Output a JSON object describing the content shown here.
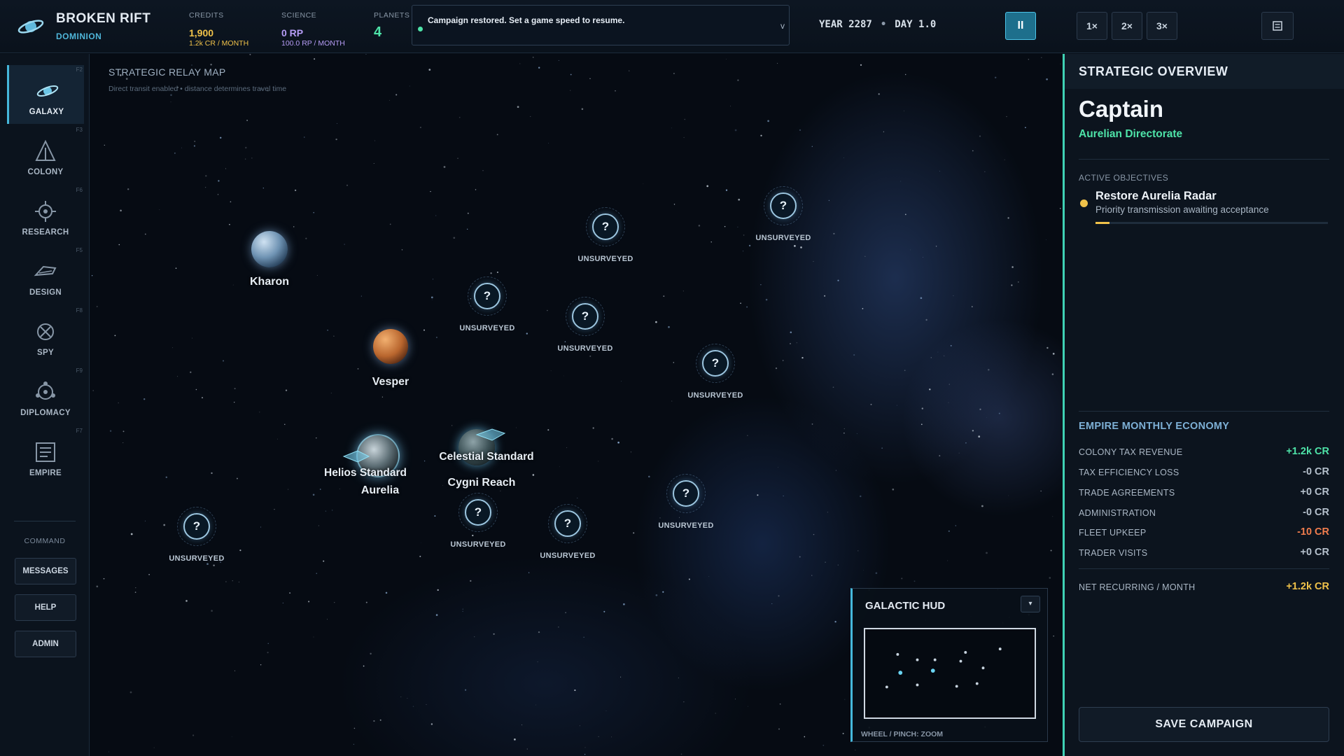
{
  "brand": {
    "title": "BROKEN RIFT",
    "subtitle": "DOMINION"
  },
  "resources": {
    "credits": {
      "label": "CREDITS",
      "value": "1,900",
      "rate": "1.2k CR / MONTH"
    },
    "science": {
      "label": "SCIENCE",
      "value": "0 RP",
      "rate": "100.0 RP / MONTH"
    },
    "planets": {
      "label": "PLANETS",
      "value": "4"
    }
  },
  "notification": {
    "text": "Campaign restored. Set a game speed to resume.",
    "chevron": "v"
  },
  "date": {
    "year": "YEAR 2287",
    "separator": "•",
    "day": "DAY 1.0"
  },
  "controls": {
    "pause": "II",
    "speed1": "1×",
    "speed2": "2×",
    "speed3": "3×",
    "menu_icon": "menu-icon"
  },
  "sidebar": {
    "items": [
      {
        "label": "GALAXY",
        "key": "F2",
        "icon": "galaxy-icon"
      },
      {
        "label": "COLONY",
        "key": "F3",
        "icon": "colony-icon"
      },
      {
        "label": "RESEARCH",
        "key": "F6",
        "icon": "research-icon"
      },
      {
        "label": "DESIGN",
        "key": "F5",
        "icon": "design-icon"
      },
      {
        "label": "SPY",
        "key": "F8",
        "icon": "spy-icon"
      },
      {
        "label": "DIPLOMACY",
        "key": "F9",
        "icon": "diplomacy-icon"
      },
      {
        "label": "EMPIRE",
        "key": "F7",
        "icon": "empire-icon"
      }
    ],
    "command_label": "COMMAND",
    "commands": [
      "MESSAGES",
      "HELP",
      "ADMIN"
    ]
  },
  "map": {
    "title": "STRATEGIC RELAY MAP",
    "subtitle": "Direct transit enabled • distance determines travel time",
    "planets": {
      "kharon": "Kharon",
      "vesper": "Vesper",
      "aurelia_fleet": "Helios Standard",
      "aurelia": "Aurelia",
      "cygni_fleet": "Celestial Standard",
      "cygni": "Cygni Reach"
    },
    "unknown_symbol": "?",
    "unsurveyed_label": "UNSURVEYED"
  },
  "minimap": {
    "title": "GALACTIC HUD",
    "toggle": "▾",
    "hint": "WHEEL / PINCH: ZOOM"
  },
  "panel": {
    "title": "STRATEGIC OVERVIEW",
    "rank": "Captain",
    "faction": "Aurelian Directorate",
    "objectives_label": "ACTIVE OBJECTIVES",
    "objective": {
      "title": "Restore Aurelia Radar",
      "desc": "Priority transmission awaiting acceptance",
      "progress": 0.06
    },
    "economy_label": "EMPIRE MONTHLY ECONOMY",
    "economy": [
      {
        "name": "COLONY TAX REVENUE",
        "value": "+1.2k CR"
      },
      {
        "name": "TAX EFFICIENCY LOSS",
        "value": "-0 CR"
      },
      {
        "name": "TRADE AGREEMENTS",
        "value": "+0 CR"
      },
      {
        "name": "ADMINISTRATION",
        "value": "-0 CR"
      },
      {
        "name": "FLEET UPKEEP",
        "value": "-10 CR"
      },
      {
        "name": "TRADER VISITS",
        "value": "+0 CR"
      }
    ],
    "net_label": "NET RECURRING / MONTH",
    "net_value": "+1.2k CR",
    "save": "SAVE CAMPAIGN"
  },
  "colors": {
    "accent": "#45b8dc",
    "positive": "#4ee3a8",
    "negative": "#f27d4e",
    "credits": "#f0c24a",
    "science": "#b59cf5"
  }
}
